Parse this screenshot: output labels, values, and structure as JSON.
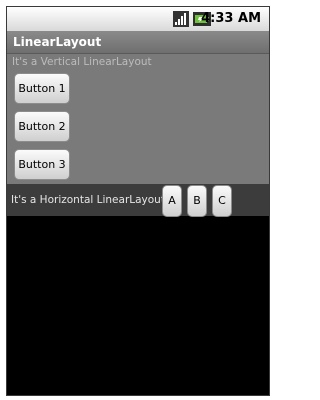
{
  "status_bar": {
    "time": "4:33 AM",
    "icons": [
      "signal-icon",
      "battery-icon"
    ]
  },
  "app": {
    "title": "LinearLayout"
  },
  "vertical_layout": {
    "label": "It's a Vertical LinearLayout",
    "buttons": [
      "Button 1",
      "Button 2",
      "Button 3"
    ]
  },
  "horizontal_layout": {
    "label": "It's a Horizontal LinearLayout",
    "buttons": [
      "A",
      "B",
      "C"
    ]
  },
  "colors": {
    "vertical_background": "#7a7a7a",
    "horizontal_background": "#3c3c3c",
    "screen_background": "#000000"
  }
}
